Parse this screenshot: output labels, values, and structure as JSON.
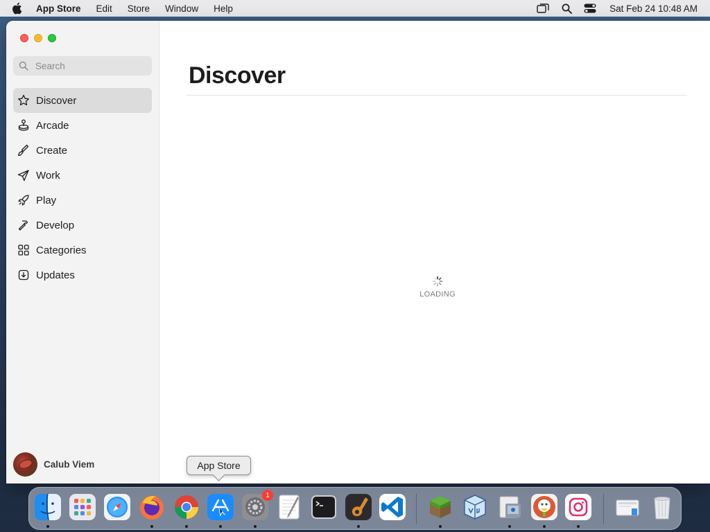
{
  "menubar": {
    "app_name": "App Store",
    "items": [
      "Edit",
      "Store",
      "Window",
      "Help"
    ],
    "clock": "Sat Feb 24  10:48 AM"
  },
  "sidebar": {
    "search_placeholder": "Search",
    "items": [
      {
        "label": "Discover",
        "icon": "star-icon",
        "active": true
      },
      {
        "label": "Arcade",
        "icon": "joystick-icon"
      },
      {
        "label": "Create",
        "icon": "brush-icon"
      },
      {
        "label": "Work",
        "icon": "paperplane-icon"
      },
      {
        "label": "Play",
        "icon": "rocket-icon"
      },
      {
        "label": "Develop",
        "icon": "hammer-icon"
      },
      {
        "label": "Categories",
        "icon": "grid-icon"
      },
      {
        "label": "Updates",
        "icon": "download-icon"
      }
    ],
    "profile_name": "Calub Viem"
  },
  "main": {
    "title": "Discover",
    "loading_label": "LOADING"
  },
  "tooltip": "App Store",
  "dock": {
    "apps": [
      "Finder",
      "Launchpad",
      "Safari",
      "Firefox",
      "Chrome",
      "App Store",
      "System Settings",
      "TextEdit",
      "Terminal",
      "GarageBand",
      "Visual Studio Code",
      "Minecraft",
      "VirtualBox",
      "Preview",
      "DuckDuckGo",
      "Instagram",
      "Downloads",
      "Trash"
    ],
    "settings_badge": "1"
  }
}
